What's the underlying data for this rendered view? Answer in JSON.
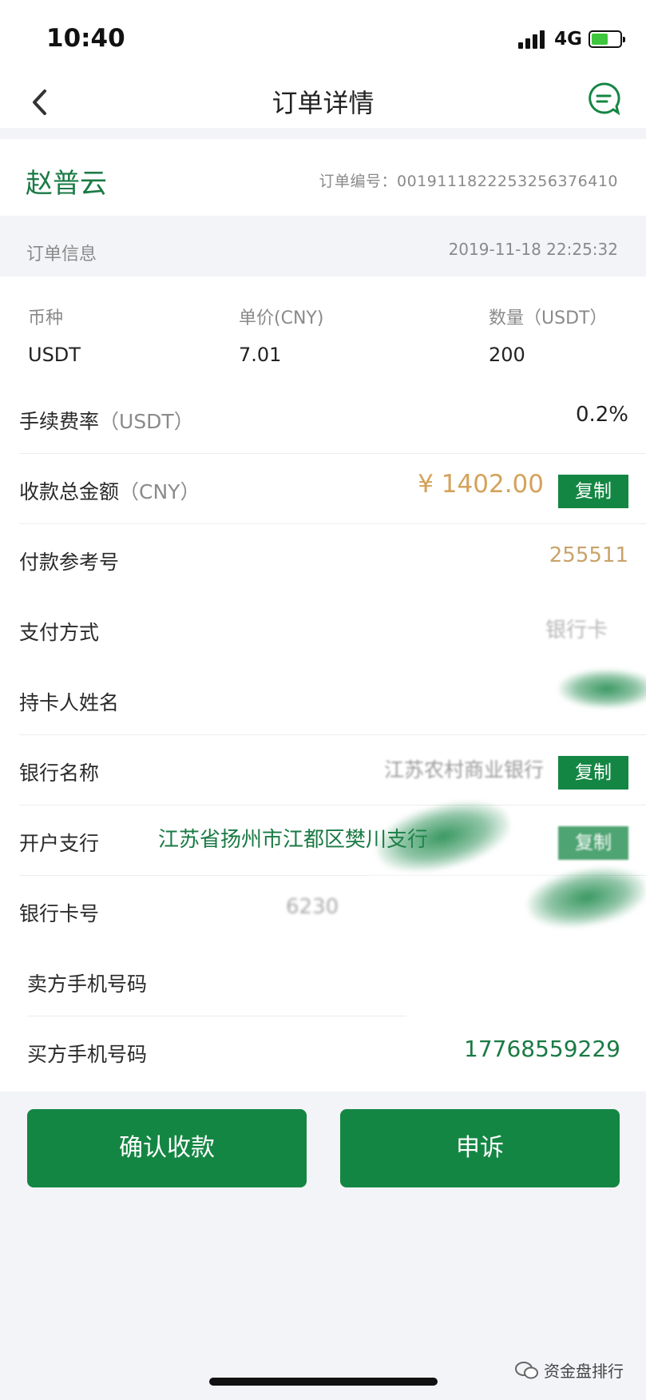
{
  "status": {
    "time": "10:40",
    "network": "4G"
  },
  "nav": {
    "title": "订单详情"
  },
  "order": {
    "seller": "赵普云",
    "order_no_label": "订单编号：",
    "order_no": "0019111822253256376410",
    "section_label": "订单信息",
    "created_at": "2019-11-18 22:25:32"
  },
  "grid": {
    "currency_label": "币种",
    "currency": "USDT",
    "price_label": "单价(CNY)",
    "price": "7.01",
    "qty_label": "数量（USDT）",
    "qty": "200"
  },
  "rows": {
    "fee": {
      "label": "手续费率",
      "unit": "（USDT）",
      "value": "0.2%"
    },
    "total": {
      "label": "收款总金额",
      "unit": "（CNY）",
      "value": "¥ 1402.00",
      "copy": "复制"
    },
    "ref": {
      "label": "付款参考号",
      "value": "255511"
    },
    "pay_method": {
      "label": "支付方式",
      "value": "银行卡"
    },
    "card_holder": {
      "label": "持卡人姓名"
    },
    "bank_name": {
      "label": "银行名称",
      "value": "江苏农村商业银行",
      "copy": "复制"
    },
    "branch": {
      "label": "开户支行",
      "value": "江苏省扬州市江都区樊川支行",
      "copy": "复制"
    },
    "card_no": {
      "label": "银行卡号",
      "value": "6230"
    },
    "seller_phone": {
      "label": "卖方手机号码"
    },
    "buyer_phone": {
      "label": "买方手机号码",
      "value": "17768559229"
    }
  },
  "actions": {
    "confirm": "确认收款",
    "appeal": "申诉"
  },
  "watermark": "资金盘排行",
  "colors": {
    "brand": "#148643",
    "amount": "#d4a25a"
  },
  "icons": {
    "back": "chevron-left-icon",
    "chat": "chat-icon",
    "wechat": "wechat-icon"
  }
}
